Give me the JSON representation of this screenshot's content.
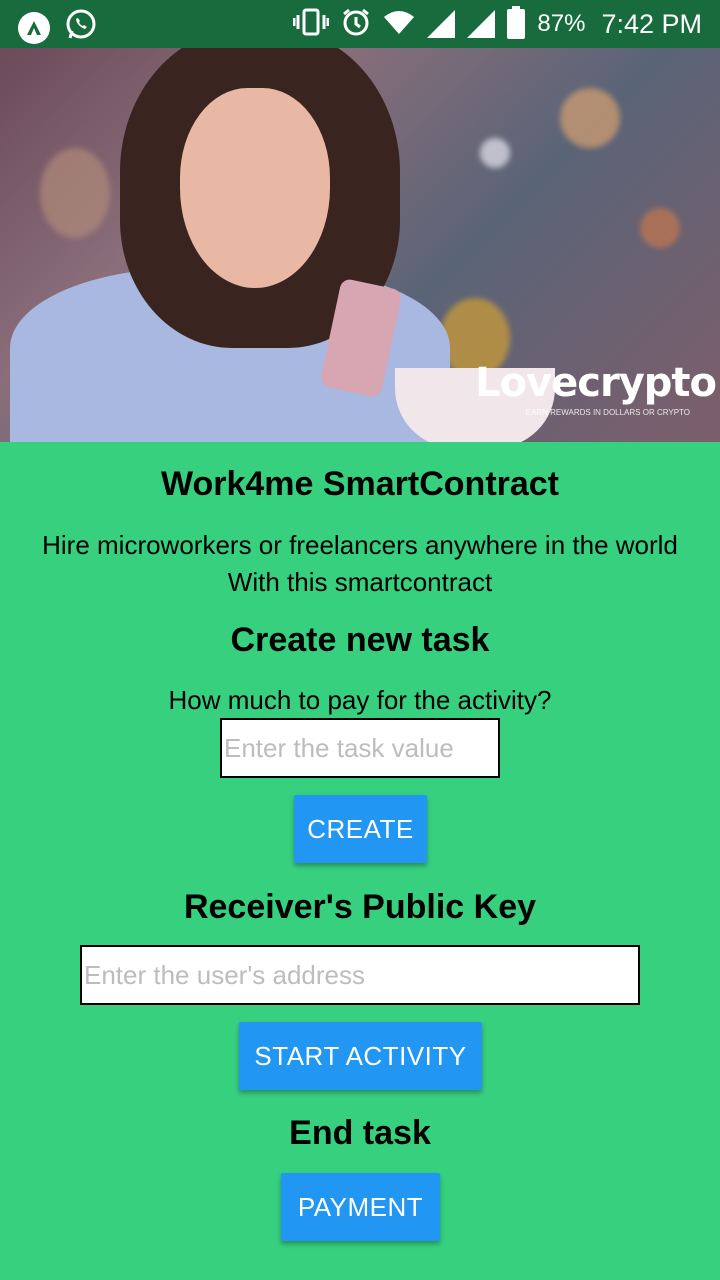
{
  "status_bar": {
    "battery": "87%",
    "time": "7:42 PM"
  },
  "hero": {
    "brand": "Lovecrypto",
    "brand_tagline": "EARN REWARDS IN DOLLARS OR CRYPTO"
  },
  "header": {
    "title": "Work4me SmartContract",
    "subtitle_line1": "Hire microworkers or freelancers anywhere in the world",
    "subtitle_line2": "With this smartcontract"
  },
  "create_task": {
    "heading": "Create new task",
    "question": "How much to pay for the activity?",
    "value_placeholder": "Enter the task value",
    "button": "CREATE"
  },
  "receiver": {
    "heading": "Receiver's Public Key",
    "address_placeholder": "Enter the user's address",
    "button": "START ACTIVITY"
  },
  "end_task": {
    "heading": "End task",
    "button": "PAYMENT"
  },
  "colors": {
    "background": "#36D07F",
    "status_bar": "#176B3C",
    "button": "#2196F3"
  }
}
